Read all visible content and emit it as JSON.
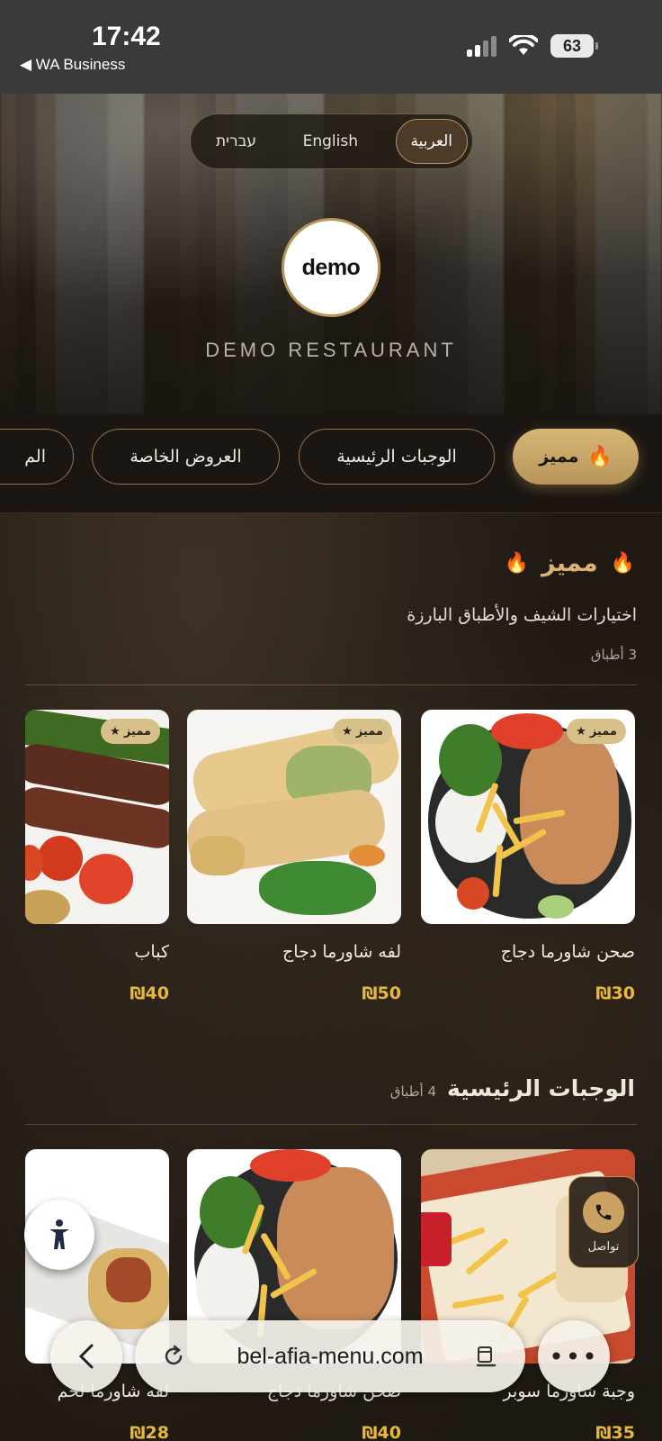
{
  "status_bar": {
    "time": "17:42",
    "back_label": "◀ WA Business",
    "battery": "63"
  },
  "language_switcher": {
    "options": [
      "עברית",
      "English",
      "العربية"
    ],
    "selected": "العربية"
  },
  "restaurant": {
    "logo_text": "demo",
    "name": "DEMO RESTAURANT"
  },
  "categories": [
    {
      "label": "مميز",
      "icon": "flame-icon",
      "active": true
    },
    {
      "label": "الوجبات الرئيسية",
      "active": false
    },
    {
      "label": "العروض الخاصة",
      "active": false
    },
    {
      "label": "الم",
      "active": false
    }
  ],
  "featured_section": {
    "title": "مميز",
    "icon": "flame-icon",
    "subtitle": "اختيارات الشيف والأطباق البارزة",
    "count": "3 أطباق",
    "items": [
      {
        "name": "صحن شاورما دجاج",
        "price": "₪30",
        "badge": "مميز"
      },
      {
        "name": "لفه شاورما دجاج",
        "price": "₪50",
        "badge": "مميز"
      },
      {
        "name": "كباب",
        "price": "₪40",
        "badge": "مميز"
      }
    ]
  },
  "main_section": {
    "title": "الوجبات الرئيسية",
    "count": "4 أطباق",
    "items": [
      {
        "name": "وجبة شاورما سوبر",
        "price": "₪35"
      },
      {
        "name": "صحن شاورما دجاج",
        "price": "₪40"
      },
      {
        "name": "لفه شاورما لحم",
        "price": "₪28"
      }
    ]
  },
  "contact_button": {
    "label": "تواصل",
    "icon": "phone-icon"
  },
  "accessibility_button": {
    "icon": "accessibility-icon"
  },
  "browser": {
    "url": "bel-afia-menu.com",
    "back_icon": "chevron-left-icon",
    "reload_icon": "reload-icon",
    "reader_icon": "reader-icon",
    "more_icon": "more-icon"
  },
  "colors": {
    "accent_gold": "#b8955a",
    "price_yellow": "#e8b838",
    "background_dark": "#1b1612",
    "flame_orange": "#ff7a1a"
  }
}
